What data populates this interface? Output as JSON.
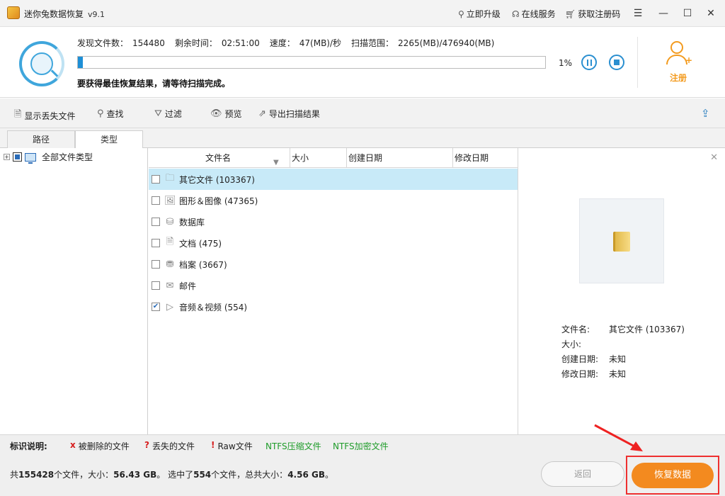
{
  "window": {
    "title": "迷你兔数据恢复",
    "version": "v9.1",
    "links": {
      "upgrade": "立即升级",
      "service": "在线服务",
      "code": "获取注册码"
    }
  },
  "scan": {
    "found_label": "发现文件数：",
    "found_value": "154480",
    "remain_label": "剩余时间：",
    "remain_value": "02:51:00",
    "speed_label": "速度：",
    "speed_value": "47(MB)/秒",
    "range_label": "扫描范围：",
    "range_value": "2265(MB)/476940(MB)",
    "progress_percent": 1,
    "progress_text": "1%",
    "note": "要获得最佳恢复结果，请等待扫描完成。",
    "register_label": "注册"
  },
  "toolbar": {
    "show_lost": "显示丢失文件",
    "find": "查找",
    "filter": "过滤",
    "preview": "预览",
    "export": "导出扫描结果"
  },
  "tabs": [
    {
      "label": "路径",
      "active": false
    },
    {
      "label": "类型",
      "active": true
    }
  ],
  "tree": {
    "root_label": "全部文件类型"
  },
  "list": {
    "columns": {
      "name": "文件名",
      "size": "大小",
      "created": "创建日期",
      "modified": "修改日期"
    },
    "rows": [
      {
        "label": "其它文件 (103367)",
        "icon": "folder-icon",
        "checked": false,
        "selected": true
      },
      {
        "label": "图形＆图像 (47365)",
        "icon": "image-icon",
        "checked": false,
        "selected": false
      },
      {
        "label": "数据库",
        "icon": "database-icon",
        "checked": false,
        "selected": false
      },
      {
        "label": "文档 (475)",
        "icon": "document-icon",
        "checked": false,
        "selected": false
      },
      {
        "label": "档案 (3667)",
        "icon": "archive-icon",
        "checked": false,
        "selected": false
      },
      {
        "label": "邮件",
        "icon": "mail-icon",
        "checked": false,
        "selected": false
      },
      {
        "label": "音频＆视频 (554)",
        "icon": "play-icon",
        "checked": true,
        "selected": false
      }
    ]
  },
  "preview": {
    "name_label": "文件名:",
    "name_value": "其它文件 (103367)",
    "size_label": "大小:",
    "size_value": "",
    "created_label": "创建日期:",
    "created_value": "未知",
    "modified_label": "修改日期:",
    "modified_value": "未知"
  },
  "legend": {
    "title": "标识说明:",
    "deleted": "被删除的文件",
    "lost": "丢失的文件",
    "raw": "Raw文件",
    "ntfs_compressed": "NTFS压缩文件",
    "ntfs_encrypted": "NTFS加密文件"
  },
  "summary": {
    "p1": "共",
    "total_files": "155428",
    "p2": "个文件，大小：",
    "total_size": "56.43 GB",
    "p3": "。 选中了",
    "selected_files": "554",
    "p4": "个文件，总共大小：",
    "selected_size": "4.56 GB",
    "p5": "。"
  },
  "buttons": {
    "back": "返回",
    "recover": "恢复数据"
  }
}
